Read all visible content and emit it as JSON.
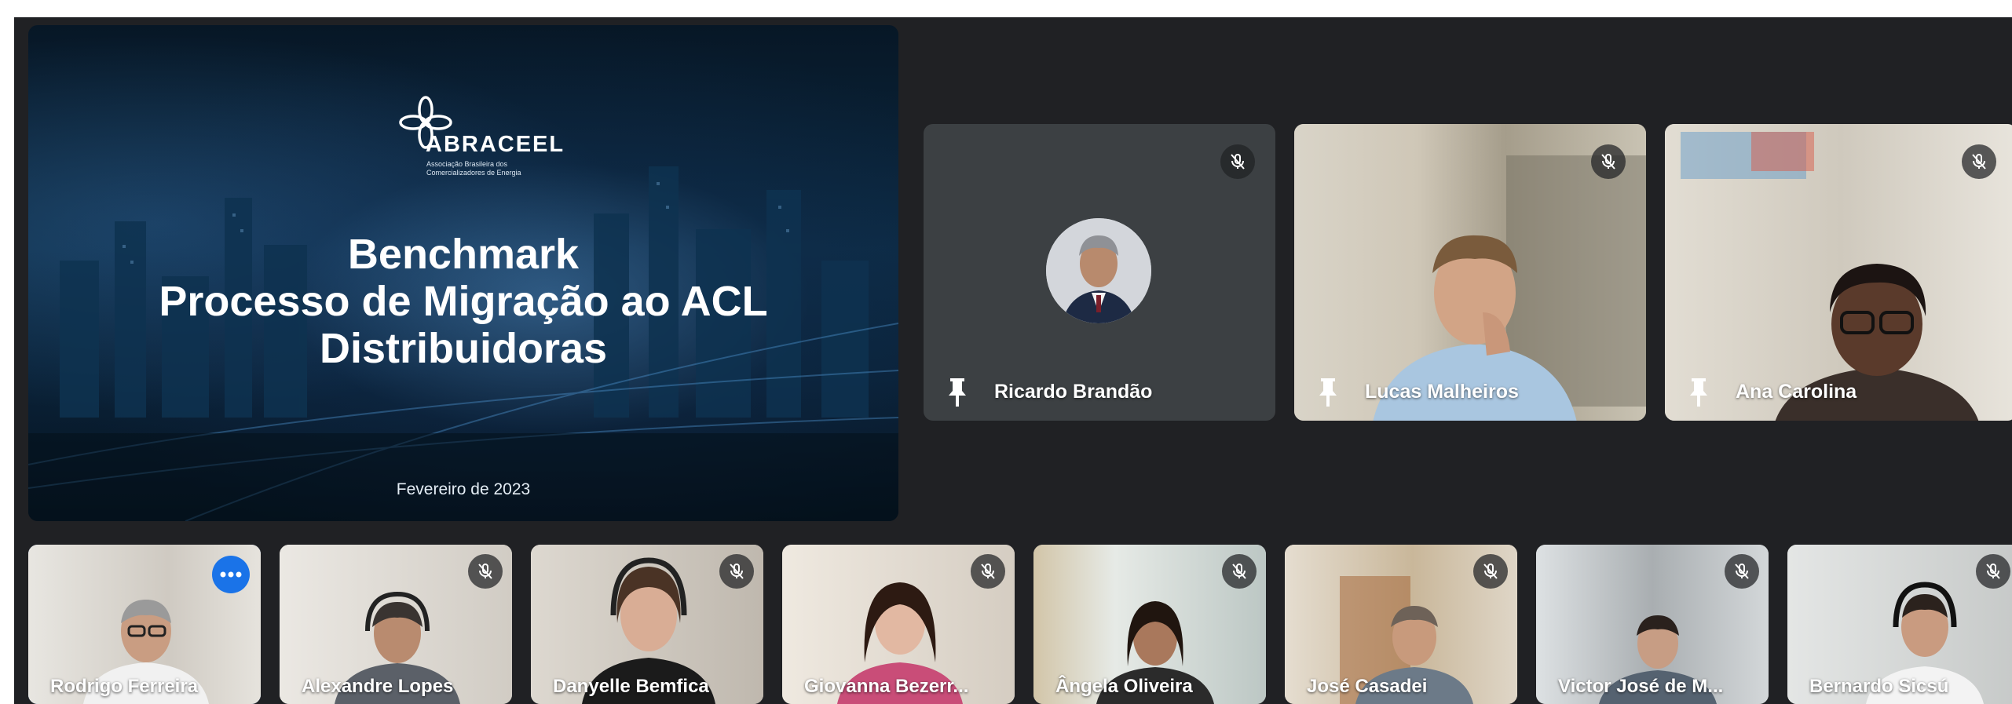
{
  "presentation": {
    "brand": "ABRACEEL",
    "brand_sub": "Associação Brasileira dos Comercializadores de Energia",
    "title_lines": [
      "Benchmark",
      "Processo de Migração ao ACL",
      "Distribuidoras"
    ],
    "date": "Fevereiro de 2023"
  },
  "featured": [
    {
      "name": "Ricardo Brandão",
      "muted": true,
      "pinned": true
    },
    {
      "name": "Lucas Malheiros",
      "muted": true,
      "pinned": true
    },
    {
      "name": "Ana Carolina",
      "muted": true,
      "pinned": true
    }
  ],
  "strip": [
    {
      "name": "Rodrigo Ferreira",
      "active_speaker": true,
      "more_options": true
    },
    {
      "name": "Alexandre Lopes",
      "muted": true
    },
    {
      "name": "Danyelle Bemfica",
      "muted": true
    },
    {
      "name": "Giovanna Bezerr...",
      "muted": true
    },
    {
      "name": "Ângela Oliveira",
      "muted": true
    },
    {
      "name": "José Casadei",
      "muted": true
    },
    {
      "name": "Victor José de M...",
      "muted": true
    },
    {
      "name": "Bernardo Sicsú",
      "muted": true
    }
  ],
  "icons": {
    "mic": "mic-off-icon",
    "pin": "pin-icon",
    "more": "more-horizontal-icon"
  },
  "colors": {
    "background": "#202124",
    "tile": "#3c4043",
    "accent": "#8ab4f8",
    "more_button": "#1a73e8"
  }
}
